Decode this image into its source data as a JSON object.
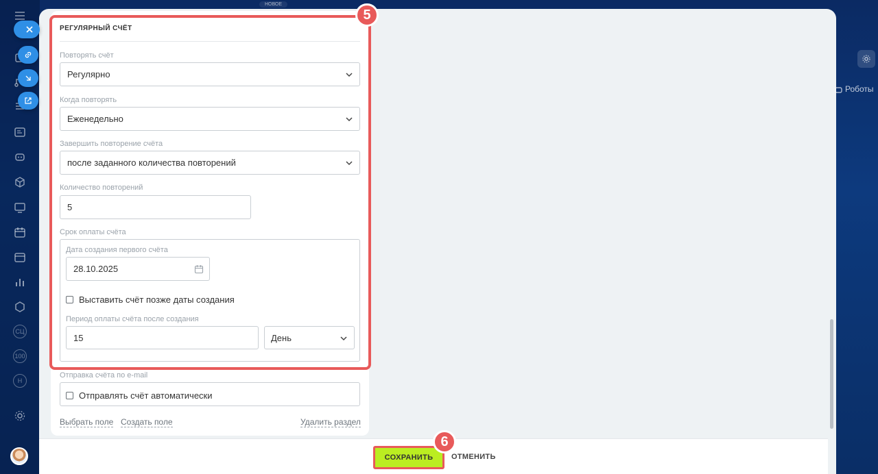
{
  "top_tab": "НОВОЕ",
  "section": {
    "title": "РЕГУЛЯРНЫЙ СЧЁТ",
    "badge": "5"
  },
  "fields": {
    "repeat": {
      "label": "Повторять счёт",
      "value": "Регулярно"
    },
    "when": {
      "label": "Когда повторять",
      "value": "Еженедельно"
    },
    "end": {
      "label": "Завершить повторение счёта",
      "value": "после заданного количества повторений"
    },
    "count": {
      "label": "Количество повторений",
      "value": "5"
    },
    "payment_term": {
      "label": "Срок оплаты счёта",
      "first_date_label": "Дата создания первого счёта",
      "first_date_value": "28.10.2025",
      "later_checkbox_label": "Выставить счёт позже даты создания",
      "period_label": "Период оплаты счёта после создания",
      "period_value": "15",
      "period_unit": "День"
    },
    "email": {
      "label": "Отправка счёта по e-mail",
      "checkbox_label": "Отправлять счёт автоматически"
    }
  },
  "links": {
    "select_field": "Выбрать поле",
    "create_field": "Создать поле",
    "delete_section": "Удалить раздел"
  },
  "footer": {
    "save": "СОХРАНИТЬ",
    "cancel": "ОТМЕНИТЬ",
    "badge": "6"
  },
  "right": {
    "robots": "Роботы"
  },
  "rail": {
    "items": [
      "menu-icon",
      "close-icon",
      "copy-icon",
      "link-icon",
      "flow-icon",
      "download-icon",
      "tasks-icon",
      "external-icon",
      "contact-card-icon",
      "robot-icon",
      "box-icon",
      "board-icon",
      "calendar-icon",
      "window-icon",
      "chart-icon",
      "hexagon-icon",
      "cc-icon",
      "io-icon",
      "n-icon",
      "gear-icon"
    ],
    "text_badges": [
      "СЦ",
      "100",
      "Н"
    ]
  },
  "colors": {
    "accent_red": "#e85a5a",
    "save_green": "#bbed21",
    "float_blue": "#2f8fe6"
  }
}
